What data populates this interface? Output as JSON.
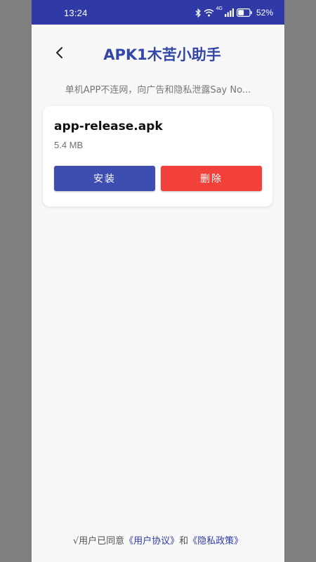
{
  "status_bar": {
    "time": "13:24",
    "network_label": "4G",
    "battery": "52%",
    "battery_level": 0.52
  },
  "header": {
    "title": "APK1木苦小助手"
  },
  "subtitle": "单机APP不连网，向广告和隐私泄露Say No...",
  "file_card": {
    "name": "app-release.apk",
    "size": "5.4 MB",
    "install_label": "安装",
    "delete_label": "删除"
  },
  "footer": {
    "prefix": "√用户已同意",
    "user_agreement": "《用户协议》",
    "and": "和",
    "privacy_policy": "《隐私政策》"
  },
  "colors": {
    "accent": "#2f3aa6",
    "install": "#3e4db0",
    "delete": "#f2403a"
  }
}
